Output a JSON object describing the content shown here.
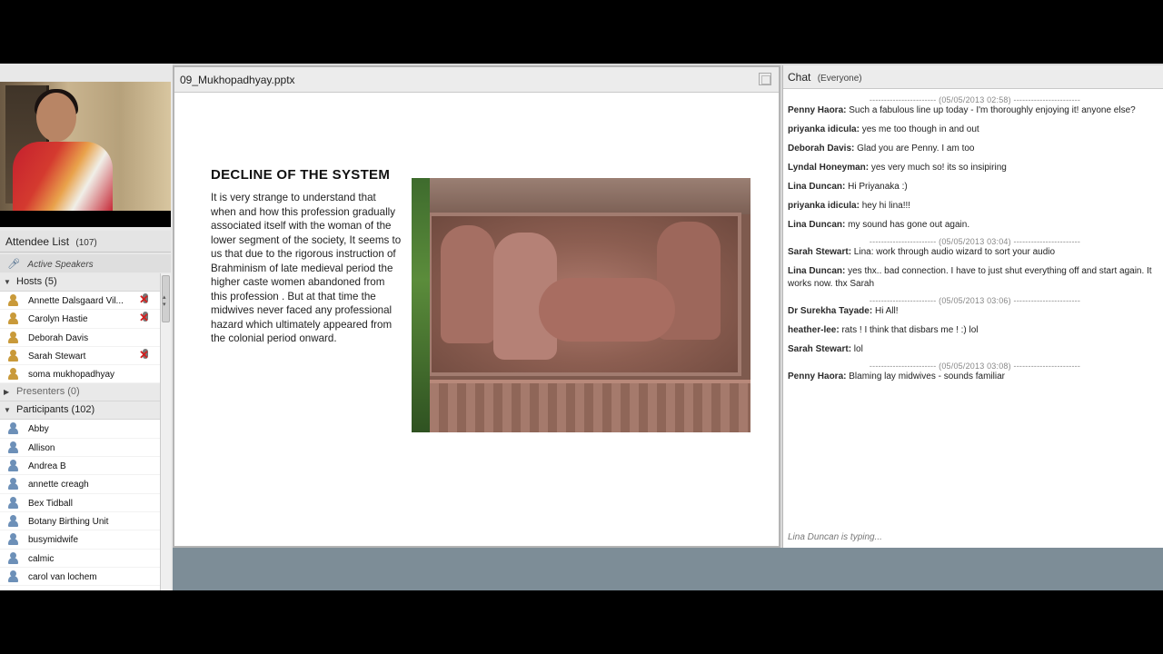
{
  "video": {
    "alt": "host webcam"
  },
  "attendee_list": {
    "title": "Attendee List",
    "count": "(107)",
    "active_speakers": "Active Speakers",
    "groups": [
      {
        "label": "Hosts (5)",
        "expanded": true,
        "members": [
          {
            "name": "Annette Dalsgaard Vil...",
            "role": "host",
            "muted": true
          },
          {
            "name": "Carolyn Hastie",
            "role": "host",
            "muted": true
          },
          {
            "name": "Deborah Davis",
            "role": "host",
            "muted": false
          },
          {
            "name": "Sarah Stewart",
            "role": "host",
            "muted": true
          },
          {
            "name": "soma mukhopadhyay",
            "role": "host",
            "muted": false
          }
        ]
      },
      {
        "label": "Presenters (0)",
        "expanded": false,
        "members": []
      },
      {
        "label": "Participants (102)",
        "expanded": true,
        "members": [
          {
            "name": "Abby",
            "role": "participant",
            "muted": false
          },
          {
            "name": "Allison",
            "role": "participant",
            "muted": false
          },
          {
            "name": "Andrea B",
            "role": "participant",
            "muted": false
          },
          {
            "name": "annette creagh",
            "role": "participant",
            "muted": false
          },
          {
            "name": "Bex Tidball",
            "role": "participant",
            "muted": false
          },
          {
            "name": "Botany Birthing Unit",
            "role": "participant",
            "muted": false
          },
          {
            "name": "busymidwife",
            "role": "participant",
            "muted": false
          },
          {
            "name": "calmic",
            "role": "participant",
            "muted": false
          },
          {
            "name": "carol van lochem",
            "role": "participant",
            "muted": false
          }
        ]
      }
    ]
  },
  "presentation": {
    "filename": "09_Mukhopadhyay.pptx",
    "slide": {
      "title": "DECLINE  OF THE  SYSTEM",
      "body": "It is very strange to understand  that when and how this profession gradually associated itself with the woman of the lower segment of the society, It seems to us that due to the rigorous instruction of Brahminism of late medieval  period the higher caste women abandoned from  this profession . But at that time the midwives never faced any professional hazard  which ultimately  appeared from the colonial period onward."
    }
  },
  "chat": {
    "title": "Chat",
    "scope": "(Everyone)",
    "entries": [
      {
        "type": "sep",
        "text": "----------------------- (05/05/2013 02:58) -----------------------"
      },
      {
        "type": "msg",
        "who": "Penny Haora:",
        "text": " Such a fabulous line up today - I'm thoroughly enjoying it! anyone else?"
      },
      {
        "type": "msg",
        "who": "priyanka idicula:",
        "text": " yes me too though in and out"
      },
      {
        "type": "msg",
        "who": "Deborah Davis:",
        "text": " Glad you are Penny.  I am too"
      },
      {
        "type": "msg",
        "who": "Lyndal Honeyman:",
        "text": " yes very much so! its so insipiring"
      },
      {
        "type": "msg",
        "who": "Lina Duncan:",
        "text": " Hi Priyanaka :)"
      },
      {
        "type": "msg",
        "who": "priyanka idicula:",
        "text": " hey hi lina!!!"
      },
      {
        "type": "msg",
        "who": "Lina Duncan:",
        "text": " my sound has gone out again."
      },
      {
        "type": "sep",
        "text": "----------------------- (05/05/2013 03:04) -----------------------"
      },
      {
        "type": "msg",
        "who": "Sarah Stewart:",
        "text": " Lina: work through audio wizard to sort your audio"
      },
      {
        "type": "msg",
        "who": "Lina Duncan:",
        "text": " yes thx.. bad connection. I have to just shut everything off and start again. It works now. thx Sarah"
      },
      {
        "type": "sep",
        "text": "----------------------- (05/05/2013 03:06) -----------------------"
      },
      {
        "type": "msg",
        "who": "Dr Surekha Tayade:",
        "text": " Hi All!"
      },
      {
        "type": "msg",
        "who": "heather-lee:",
        "text": " rats !  I think that disbars me  !  :) lol"
      },
      {
        "type": "msg",
        "who": "Sarah Stewart:",
        "text": " lol"
      },
      {
        "type": "sep",
        "text": "----------------------- (05/05/2013 03:08) -----------------------"
      },
      {
        "type": "msg",
        "who": "Penny Haora:",
        "text": " Blaming lay midwives - sounds familiar"
      }
    ],
    "typing": "Lina Duncan is typing..."
  },
  "colors": {
    "host_icon": "#c99a3a",
    "participant_icon": "#6d90b8",
    "mute_x": "#d21f1f",
    "bottom_bar": "#7d8d97"
  }
}
